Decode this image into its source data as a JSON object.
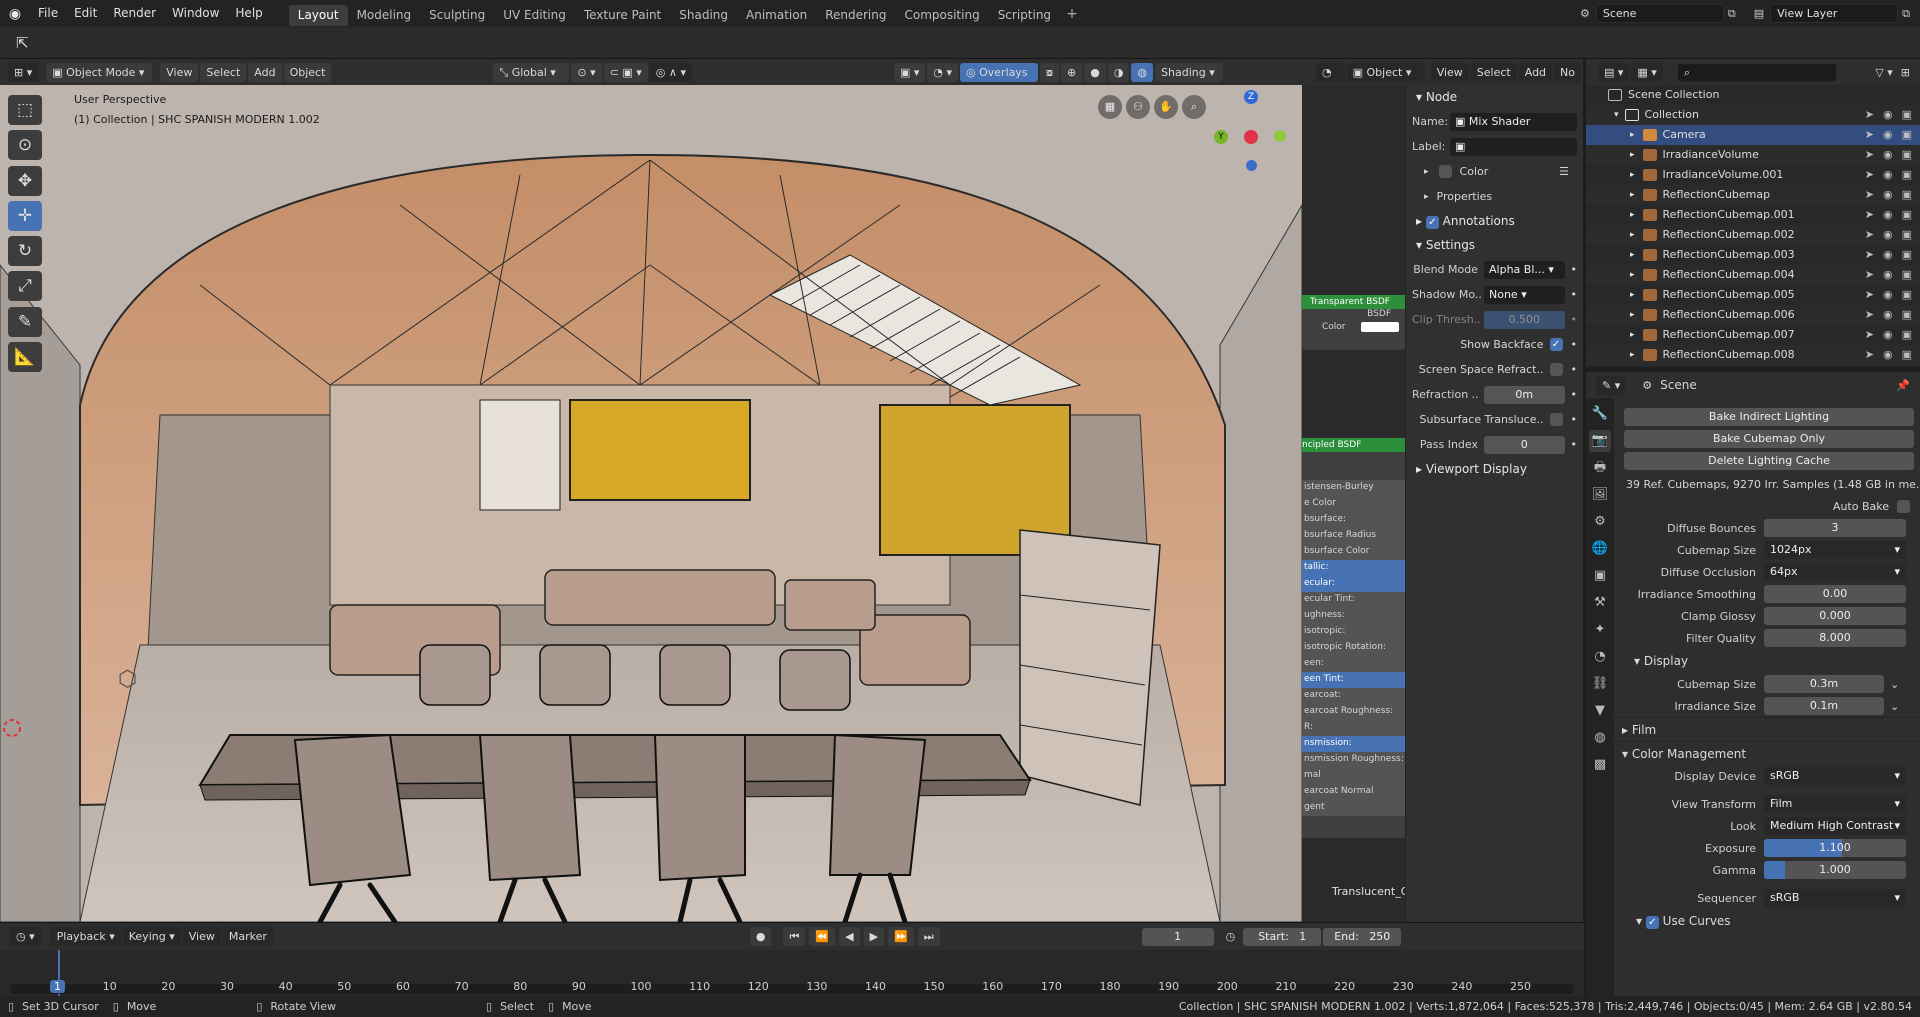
{
  "menubar": {
    "items": [
      "File",
      "Edit",
      "Render",
      "Window",
      "Help"
    ],
    "workspaces": [
      "Layout",
      "Modeling",
      "Sculpting",
      "UV Editing",
      "Texture Paint",
      "Shading",
      "Animation",
      "Rendering",
      "Compositing",
      "Scripting"
    ],
    "active_workspace": "Layout",
    "scene": "Scene",
    "view_layer": "View Layer"
  },
  "viewport": {
    "mode": "Object Mode",
    "menus": [
      "View",
      "Select",
      "Add",
      "Object"
    ],
    "orientation": "Global",
    "overlays": "Overlays",
    "shading": "Shading",
    "perspective": "User Perspective",
    "collection_info": "(1) Collection | SHC SPANISH MODERN 1.002",
    "gizmo_z": "Z",
    "gizmo_y": "Y"
  },
  "node_editor": {
    "object": "Object",
    "menus": [
      "View",
      "Select",
      "Add",
      "No"
    ],
    "nodes": {
      "transparent": "Transparent BSDF",
      "bsdf": "BSDF",
      "color": "Color",
      "principled": "ncipled BSDF",
      "sockets": [
        "istensen-Burley",
        "e Color",
        "bsurface:",
        "bsurface Radius",
        "bsurface Color",
        "tallic:",
        "ecular:",
        "ecular Tint:",
        "ughness:",
        "isotropic:",
        "isotropic Rotation:",
        "een:",
        "een Tint:",
        "earcoat:",
        "earcoat Roughness:",
        "R:",
        "nsmission:",
        "nsmission Roughness:",
        "mal",
        "earcoat Normal",
        "gent"
      ],
      "translucent": "Translucent_G"
    }
  },
  "npanel": {
    "node_header": "Node",
    "name_label": "Name:",
    "name_value": "Mix Shader",
    "label_label": "Label:",
    "color_label": "Color",
    "properties_label": "Properties",
    "annotations_label": "Annotations",
    "settings_label": "Settings",
    "blend_mode_label": "Blend Mode",
    "blend_mode_value": "Alpha Bl...",
    "shadow_mode_label": "Shadow Mo..",
    "shadow_mode_value": "None",
    "clip_label": "Clip Thresh..",
    "clip_value": "0.500",
    "show_backface_label": "Show Backface",
    "ssr_label": "Screen Space Refract..",
    "refraction_label": "Refraction ..",
    "refraction_value": "0m",
    "sss_label": "Subsurface Translucе..",
    "pass_index_label": "Pass Index",
    "pass_index_value": "0",
    "viewport_display_label": "Viewport Display"
  },
  "outliner": {
    "root": "Scene Collection",
    "collection": "Collection",
    "items": [
      "Camera",
      "IrradianceVolume",
      "IrradianceVolume.001",
      "ReflectionCubemap",
      "ReflectionCubemap.001",
      "ReflectionCubemap.002",
      "ReflectionCubemap.003",
      "ReflectionCubemap.004",
      "ReflectionCubemap.005",
      "ReflectionCubemap.006",
      "ReflectionCubemap.007",
      "ReflectionCubemap.008"
    ]
  },
  "properties": {
    "context": "Scene",
    "bake_indirect": "Bake Indirect Lighting",
    "bake_cubemap": "Bake Cubemap Only",
    "delete_cache": "Delete Lighting Cache",
    "cache_info": "39 Ref. Cubemaps, 9270 Irr. Samples (1.48 GB in me..",
    "auto_bake": "Auto Bake",
    "diffuse_bounces_label": "Diffuse Bounces",
    "diffuse_bounces": "3",
    "cubemap_size_label": "Cubemap Size",
    "cubemap_size": "1024px",
    "diffuse_occlusion_label": "Diffuse Occlusion",
    "diffuse_occlusion": "64px",
    "irradiance_smoothing_label": "Irradiance Smoothing",
    "irradiance_smoothing": "0.00",
    "clamp_glossy_label": "Clamp Glossy",
    "clamp_glossy": "0.000",
    "filter_quality_label": "Filter Quality",
    "filter_quality": "8.000",
    "display_label": "Display",
    "disp_cubemap_label": "Cubemap Size",
    "disp_cubemap": "0.3m",
    "disp_irradiance_label": "Irradiance Size",
    "disp_irradiance": "0.1m",
    "film_label": "Film",
    "color_mgmt_label": "Color Management",
    "display_device_label": "Display Device",
    "display_device": "sRGB",
    "view_transform_label": "View Transform",
    "view_transform": "Film",
    "look_label": "Look",
    "look": "Medium High Contrast",
    "exposure_label": "Exposure",
    "exposure": "1.100",
    "exposure_fill": 0.55,
    "gamma_label": "Gamma",
    "gamma": "1.000",
    "gamma_fill": 0.15,
    "sequencer_label": "Sequencer",
    "sequencer": "sRGB",
    "use_curves_label": "Use Curves"
  },
  "timeline": {
    "menus": [
      "Playback",
      "Keying",
      "View",
      "Marker"
    ],
    "current_frame": "1",
    "start_label": "Start:",
    "start": "1",
    "end_label": "End:",
    "end": "250",
    "ticks": [
      "1",
      "10",
      "20",
      "30",
      "40",
      "50",
      "60",
      "70",
      "80",
      "90",
      "100",
      "110",
      "120",
      "130",
      "140",
      "150",
      "160",
      "170",
      "180",
      "190",
      "200",
      "210",
      "220",
      "230",
      "240",
      "250"
    ]
  },
  "statusbar": {
    "set_cursor": "Set 3D Cursor",
    "move": "Move",
    "rotate": "Rotate View",
    "select": "Select",
    "move2": "Move",
    "stats": "Collection | SHC SPANISH MODERN 1.002 | Verts:1,872,064 | Faces:525,378 | Tris:2,449,746 | Objects:0/45 | Mem: 2.64 GB | v2.80.54"
  },
  "colors": {
    "accent": "#4772b3",
    "node_green": "#2c8f3a",
    "selected_row": "#334d80"
  }
}
